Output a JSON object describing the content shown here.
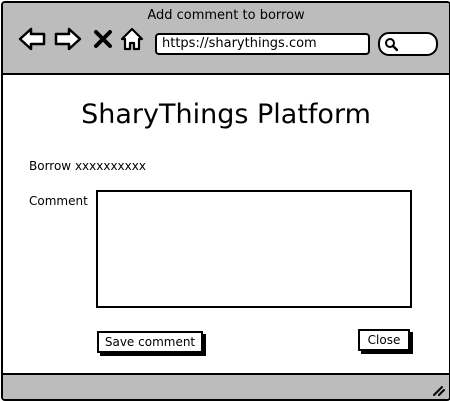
{
  "window": {
    "title": "Add comment to borrow",
    "address": "https://sharythings.com",
    "nav_icons": [
      "back-arrow-icon",
      "forward-arrow-icon",
      "close-x-icon",
      "home-icon"
    ]
  },
  "page": {
    "title": "SharyThings Platform",
    "borrow_label": "Borrow xxxxxxxxxx",
    "comment_label": "Comment",
    "comment_value": "",
    "save_label": "Save comment",
    "close_label": "Close"
  }
}
